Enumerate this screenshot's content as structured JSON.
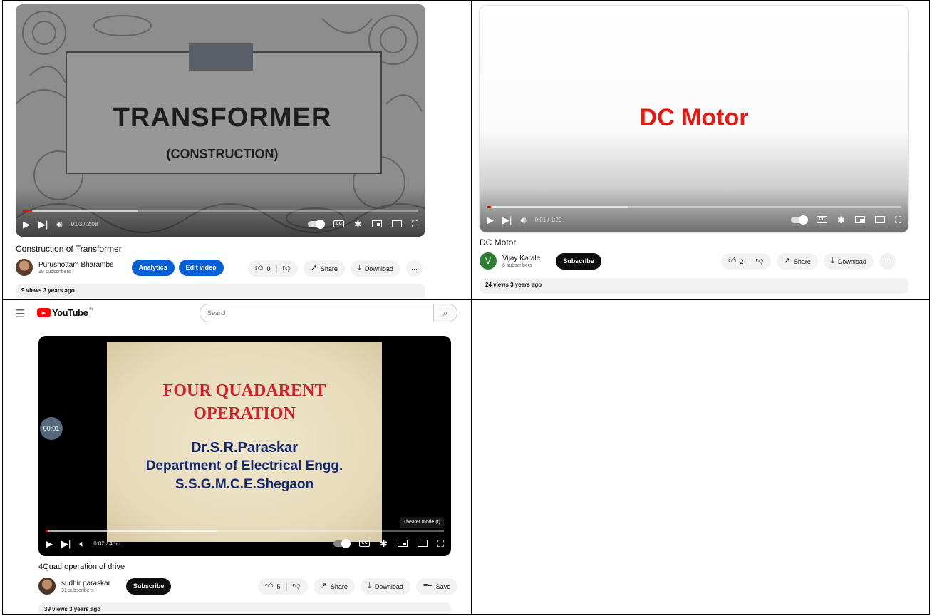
{
  "panels": [
    {
      "slide": {
        "title": "TRANSFORMER",
        "subtitle": "(CONSTRUCTION)"
      },
      "player": {
        "time": "0:03 / 2:08",
        "progress": 0.023,
        "buffered": 0.29
      },
      "video_title": "Construction of Transformer",
      "channel": {
        "name": "Purushottam Bharambe",
        "subscribers": "19 subscribers"
      },
      "analytics_label": "Analytics",
      "edit_label": "Edit video",
      "likes": "0",
      "share_label": "Share",
      "download_label": "Download",
      "more_label": "···",
      "stats": "9 views  3 years ago"
    },
    {
      "slide": {
        "title": "DC Motor"
      },
      "player": {
        "time": "0:01 / 1:29",
        "progress": 0.011,
        "buffered": 0.34
      },
      "video_title": "DC Motor",
      "channel": {
        "name": "Vijay Karale",
        "subscribers": "6 subscribers",
        "avatar_letter": "V"
      },
      "subscribe_label": "Subscribe",
      "likes": "2",
      "share_label": "Share",
      "download_label": "Download",
      "more_label": "···",
      "stats": "24 views  3 years ago"
    },
    {
      "header": {
        "logo": "YouTube",
        "region": "IN",
        "search_placeholder": "Search"
      },
      "slide": {
        "line1": "FOUR QUADARENT",
        "line2": "OPERATION",
        "line3": "Dr.S.R.Paraskar",
        "line4": "Department of Electrical Engg.",
        "line5": "S.S.G.M.C.E.Shegaon",
        "timestamp_badge": "00:01"
      },
      "tooltip": "Theater mode (t)",
      "player": {
        "time": "0:02 / 4:56",
        "progress": 0.007,
        "buffered": 0.43
      },
      "video_title": "4Quad operation of drive",
      "channel": {
        "name": "sudhir paraskar",
        "subscribers": "31 subscribers"
      },
      "subscribe_label": "Subscribe",
      "likes": "5",
      "share_label": "Share",
      "download_label": "Download",
      "save_label": "Save",
      "stats": "39 views  3 years ago"
    }
  ],
  "colors": {
    "accent_red": "#ff0000",
    "subscribe_black": "#0f0f0f",
    "analytics_blue": "#065fd4",
    "dc_motor_red": "#e3180f",
    "slide_red": "#d3202a",
    "slide_navy": "#13256b"
  }
}
